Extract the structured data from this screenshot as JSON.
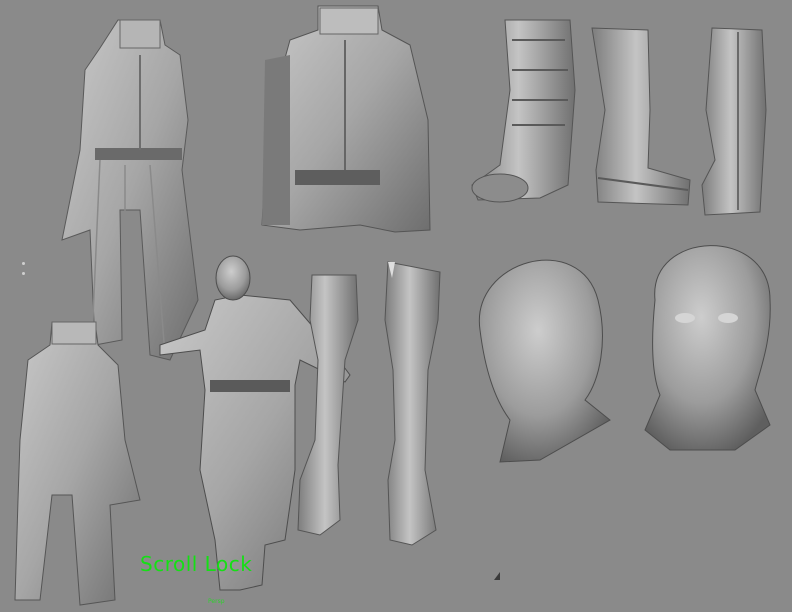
{
  "viewport": {
    "background": "#8a8a8a",
    "models": [
      {
        "name": "vest-with-skirt-front",
        "icon": "vest-icon"
      },
      {
        "name": "vest-close-up",
        "icon": "vest-icon"
      },
      {
        "name": "boot-front",
        "icon": "boot-icon"
      },
      {
        "name": "boot-side",
        "icon": "boot-icon"
      },
      {
        "name": "boot-back",
        "icon": "boot-icon"
      },
      {
        "name": "vest-back",
        "icon": "vest-icon"
      },
      {
        "name": "full-character-tpose",
        "icon": "character-icon"
      },
      {
        "name": "arm-front",
        "icon": "arm-icon"
      },
      {
        "name": "arm-back",
        "icon": "arm-icon"
      },
      {
        "name": "head-three-quarter",
        "icon": "head-icon"
      },
      {
        "name": "head-front",
        "icon": "head-icon"
      }
    ]
  },
  "status": {
    "scroll_lock": "Scroll Lock ",
    "scroll_lock_color": "#14e014",
    "bottom_label": "Persp"
  }
}
